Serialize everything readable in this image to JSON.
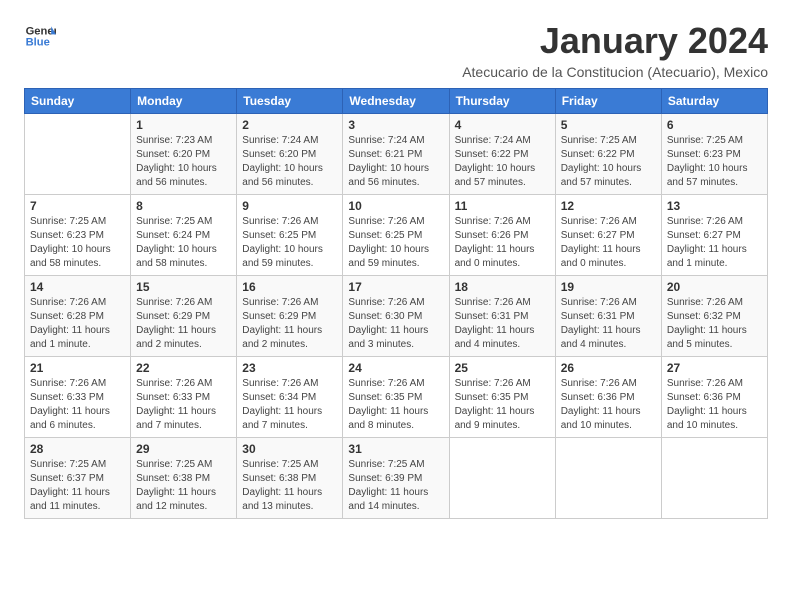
{
  "header": {
    "logo_general": "General",
    "logo_blue": "Blue",
    "month_title": "January 2024",
    "subtitle": "Atecucario de la Constitucion (Atecuario), Mexico"
  },
  "weekdays": [
    "Sunday",
    "Monday",
    "Tuesday",
    "Wednesday",
    "Thursday",
    "Friday",
    "Saturday"
  ],
  "weeks": [
    [
      {
        "day": "",
        "info": ""
      },
      {
        "day": "1",
        "info": "Sunrise: 7:23 AM\nSunset: 6:20 PM\nDaylight: 10 hours\nand 56 minutes."
      },
      {
        "day": "2",
        "info": "Sunrise: 7:24 AM\nSunset: 6:20 PM\nDaylight: 10 hours\nand 56 minutes."
      },
      {
        "day": "3",
        "info": "Sunrise: 7:24 AM\nSunset: 6:21 PM\nDaylight: 10 hours\nand 56 minutes."
      },
      {
        "day": "4",
        "info": "Sunrise: 7:24 AM\nSunset: 6:22 PM\nDaylight: 10 hours\nand 57 minutes."
      },
      {
        "day": "5",
        "info": "Sunrise: 7:25 AM\nSunset: 6:22 PM\nDaylight: 10 hours\nand 57 minutes."
      },
      {
        "day": "6",
        "info": "Sunrise: 7:25 AM\nSunset: 6:23 PM\nDaylight: 10 hours\nand 57 minutes."
      }
    ],
    [
      {
        "day": "7",
        "info": "Sunrise: 7:25 AM\nSunset: 6:23 PM\nDaylight: 10 hours\nand 58 minutes."
      },
      {
        "day": "8",
        "info": "Sunrise: 7:25 AM\nSunset: 6:24 PM\nDaylight: 10 hours\nand 58 minutes."
      },
      {
        "day": "9",
        "info": "Sunrise: 7:26 AM\nSunset: 6:25 PM\nDaylight: 10 hours\nand 59 minutes."
      },
      {
        "day": "10",
        "info": "Sunrise: 7:26 AM\nSunset: 6:25 PM\nDaylight: 10 hours\nand 59 minutes."
      },
      {
        "day": "11",
        "info": "Sunrise: 7:26 AM\nSunset: 6:26 PM\nDaylight: 11 hours\nand 0 minutes."
      },
      {
        "day": "12",
        "info": "Sunrise: 7:26 AM\nSunset: 6:27 PM\nDaylight: 11 hours\nand 0 minutes."
      },
      {
        "day": "13",
        "info": "Sunrise: 7:26 AM\nSunset: 6:27 PM\nDaylight: 11 hours\nand 1 minute."
      }
    ],
    [
      {
        "day": "14",
        "info": "Sunrise: 7:26 AM\nSunset: 6:28 PM\nDaylight: 11 hours\nand 1 minute."
      },
      {
        "day": "15",
        "info": "Sunrise: 7:26 AM\nSunset: 6:29 PM\nDaylight: 11 hours\nand 2 minutes."
      },
      {
        "day": "16",
        "info": "Sunrise: 7:26 AM\nSunset: 6:29 PM\nDaylight: 11 hours\nand 2 minutes."
      },
      {
        "day": "17",
        "info": "Sunrise: 7:26 AM\nSunset: 6:30 PM\nDaylight: 11 hours\nand 3 minutes."
      },
      {
        "day": "18",
        "info": "Sunrise: 7:26 AM\nSunset: 6:31 PM\nDaylight: 11 hours\nand 4 minutes."
      },
      {
        "day": "19",
        "info": "Sunrise: 7:26 AM\nSunset: 6:31 PM\nDaylight: 11 hours\nand 4 minutes."
      },
      {
        "day": "20",
        "info": "Sunrise: 7:26 AM\nSunset: 6:32 PM\nDaylight: 11 hours\nand 5 minutes."
      }
    ],
    [
      {
        "day": "21",
        "info": "Sunrise: 7:26 AM\nSunset: 6:33 PM\nDaylight: 11 hours\nand 6 minutes."
      },
      {
        "day": "22",
        "info": "Sunrise: 7:26 AM\nSunset: 6:33 PM\nDaylight: 11 hours\nand 7 minutes."
      },
      {
        "day": "23",
        "info": "Sunrise: 7:26 AM\nSunset: 6:34 PM\nDaylight: 11 hours\nand 7 minutes."
      },
      {
        "day": "24",
        "info": "Sunrise: 7:26 AM\nSunset: 6:35 PM\nDaylight: 11 hours\nand 8 minutes."
      },
      {
        "day": "25",
        "info": "Sunrise: 7:26 AM\nSunset: 6:35 PM\nDaylight: 11 hours\nand 9 minutes."
      },
      {
        "day": "26",
        "info": "Sunrise: 7:26 AM\nSunset: 6:36 PM\nDaylight: 11 hours\nand 10 minutes."
      },
      {
        "day": "27",
        "info": "Sunrise: 7:26 AM\nSunset: 6:36 PM\nDaylight: 11 hours\nand 10 minutes."
      }
    ],
    [
      {
        "day": "28",
        "info": "Sunrise: 7:25 AM\nSunset: 6:37 PM\nDaylight: 11 hours\nand 11 minutes."
      },
      {
        "day": "29",
        "info": "Sunrise: 7:25 AM\nSunset: 6:38 PM\nDaylight: 11 hours\nand 12 minutes."
      },
      {
        "day": "30",
        "info": "Sunrise: 7:25 AM\nSunset: 6:38 PM\nDaylight: 11 hours\nand 13 minutes."
      },
      {
        "day": "31",
        "info": "Sunrise: 7:25 AM\nSunset: 6:39 PM\nDaylight: 11 hours\nand 14 minutes."
      },
      {
        "day": "",
        "info": ""
      },
      {
        "day": "",
        "info": ""
      },
      {
        "day": "",
        "info": ""
      }
    ]
  ]
}
